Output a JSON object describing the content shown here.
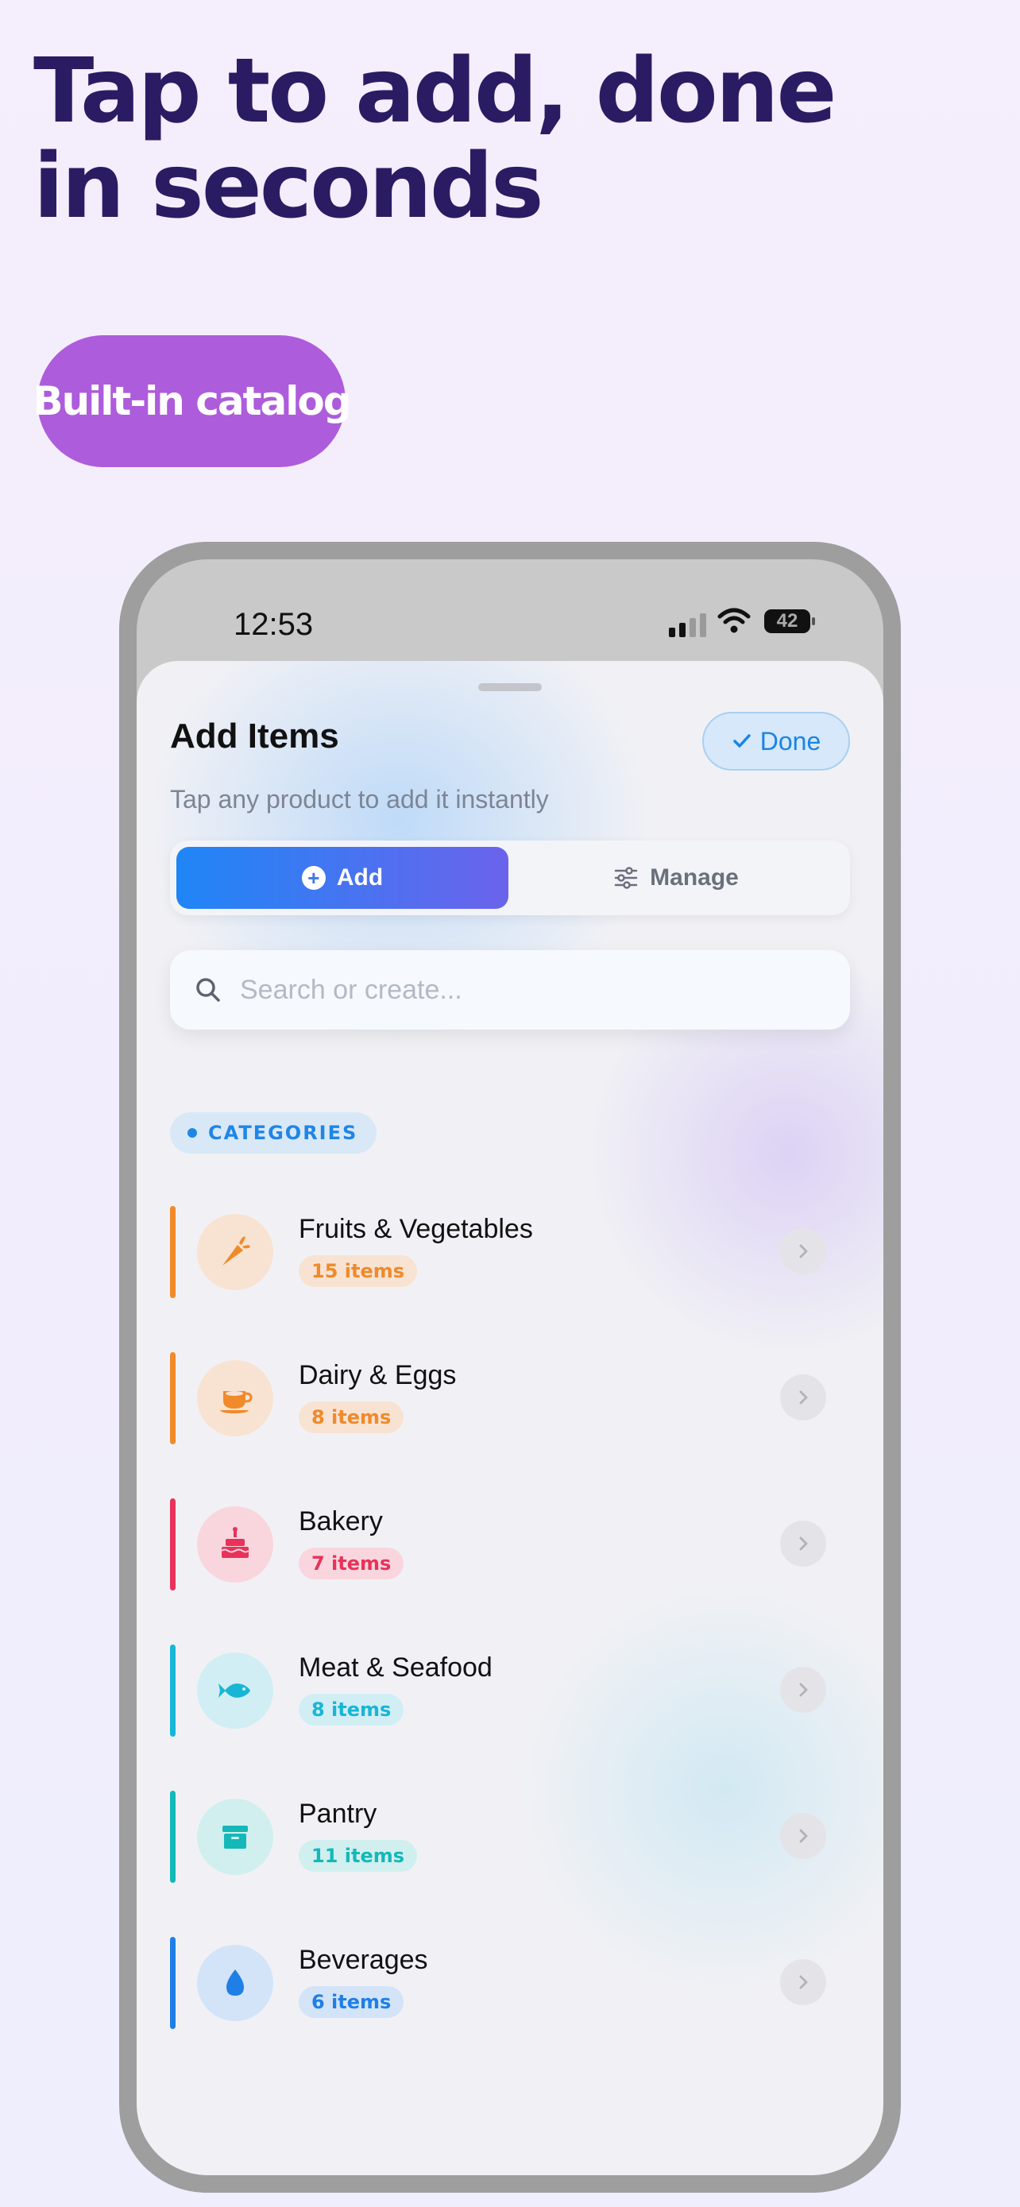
{
  "headline": "Tap to add, done in seconds",
  "feature_pill": "Built-in catalog",
  "status_bar": {
    "time": "12:53",
    "battery": "42"
  },
  "sheet": {
    "title": "Add Items",
    "done_label": "Done",
    "subtitle": "Tap any product to add it instantly",
    "segments": {
      "add": "Add",
      "manage": "Manage"
    },
    "search": {
      "placeholder": "Search or create..."
    },
    "section_label": "CATEGORIES",
    "categories": [
      {
        "name": "Fruits & Vegetables",
        "count": "15 items",
        "icon": "carrot-icon",
        "accent": "#f08a2a",
        "tint": "#f8e3d2"
      },
      {
        "name": "Dairy & Eggs",
        "count": "8 items",
        "icon": "coffee-cup-icon",
        "accent": "#f08a2a",
        "tint": "#f8e3d2"
      },
      {
        "name": "Bakery",
        "count": "7 items",
        "icon": "cake-icon",
        "accent": "#e8325a",
        "tint": "#f9d6de"
      },
      {
        "name": "Meat & Seafood",
        "count": "8 items",
        "icon": "fish-icon",
        "accent": "#18b6d6",
        "tint": "#d1eef5"
      },
      {
        "name": "Pantry",
        "count": "11 items",
        "icon": "archive-box-icon",
        "accent": "#14b8b8",
        "tint": "#d1efef"
      },
      {
        "name": "Beverages",
        "count": "6 items",
        "icon": "water-drop-icon",
        "accent": "#1f7fe6",
        "tint": "#d3e4f8"
      }
    ]
  }
}
